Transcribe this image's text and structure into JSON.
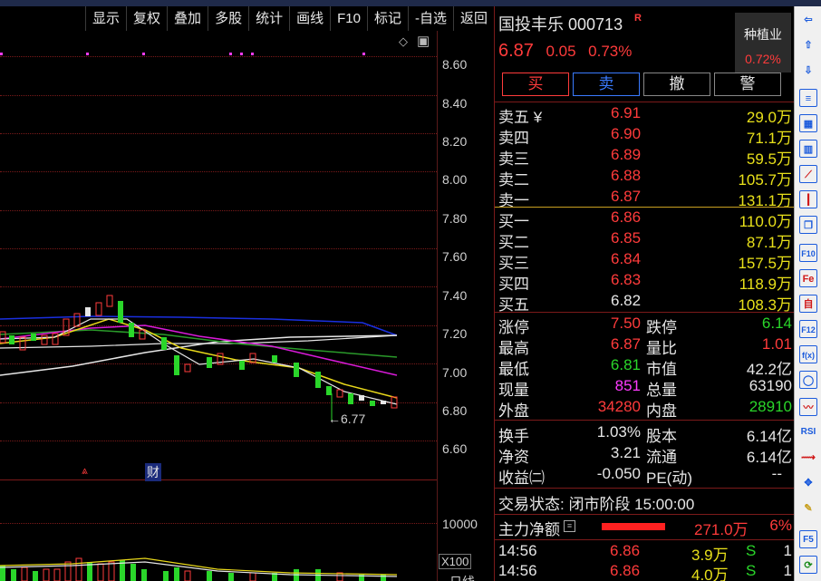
{
  "toolbar": [
    "显示",
    "复权",
    "叠加",
    "多股",
    "统计",
    "画线",
    "F10",
    "标记",
    "-自选",
    "返回"
  ],
  "price_axis": [
    "8.60",
    "8.40",
    "8.20",
    "8.00",
    "7.80",
    "7.60",
    "7.40",
    "7.20",
    "7.00",
    "6.80",
    "6.60"
  ],
  "chart_markers": {
    "low_label": "←6.77",
    "fin_label": "财",
    "vol_axis": "10000",
    "vol_unit": "X100",
    "bottom_tab": "日线"
  },
  "stock": {
    "name": "国投丰乐",
    "code": "000713",
    "r_mark": "R",
    "price": "6.87",
    "change": "0.05",
    "pct": "0.73%"
  },
  "sector": {
    "name": "种植业",
    "pct": "0.72%"
  },
  "buttons": {
    "buy": "买",
    "sell": "卖",
    "cancel": "撤",
    "alert": "警"
  },
  "asks": [
    {
      "label": "卖五 ¥",
      "price": "6.91",
      "vol": "29.0万"
    },
    {
      "label": "卖四",
      "price": "6.90",
      "vol": "71.1万"
    },
    {
      "label": "卖三",
      "price": "6.89",
      "vol": "59.5万"
    },
    {
      "label": "卖二",
      "price": "6.88",
      "vol": "105.7万"
    },
    {
      "label": "卖一",
      "price": "6.87",
      "vol": "131.1万"
    }
  ],
  "bids": [
    {
      "label": "买一",
      "price": "6.86",
      "vol": "110.0万"
    },
    {
      "label": "买二",
      "price": "6.85",
      "vol": "87.1万"
    },
    {
      "label": "买三",
      "price": "6.84",
      "vol": "157.5万"
    },
    {
      "label": "买四",
      "price": "6.83",
      "vol": "118.9万"
    },
    {
      "label": "买五",
      "price": "6.82",
      "vol": "108.3万"
    }
  ],
  "stats": {
    "zt_l": "涨停",
    "zt_v": "7.50",
    "dt_l": "跌停",
    "dt_v": "6.14",
    "hi_l": "最高",
    "hi_v": "6.87",
    "lb_l": "量比",
    "lb_v": "1.01",
    "lo_l": "最低",
    "lo_v": "6.81",
    "mv_l": "市值",
    "mv_v": "42.2亿",
    "xl_l": "现量",
    "xl_v": "851",
    "zl_l": "总量",
    "zl_v": "63190",
    "wp_l": "外盘",
    "wp_v": "34280",
    "np_l": "内盘",
    "np_v": "28910"
  },
  "stats2": {
    "hs_l": "换手",
    "hs_v": "1.03%",
    "gb_l": "股本",
    "gb_v": "6.14亿",
    "jz_l": "净资",
    "jz_v": "3.21",
    "lt_l": "流通",
    "lt_v": "6.14亿",
    "sy_l": "收益㈡",
    "sy_v": "-0.050",
    "pe_l": "PE(动)",
    "pe_v": "--"
  },
  "status": {
    "text": "交易状态: 闭市阶段 15:00:00"
  },
  "flow": {
    "label": "主力净额",
    "value": "271.0万",
    "pct": "6%"
  },
  "ticks": [
    {
      "time": "14:56",
      "price": "6.86",
      "vol": "3.9万",
      "side": "S",
      "n": "1"
    },
    {
      "time": "14:56",
      "price": "6.86",
      "vol": "4.0万",
      "side": "S",
      "n": "1"
    }
  ],
  "sidebar_icons": [
    "left-arrow-icon",
    "up-arrow-icon",
    "down-arrow-icon",
    "list-icon",
    "grid-icon",
    "bars-icon",
    "line-chart-icon",
    "candles-icon",
    "windows-icon",
    "f10-icon",
    "fe-icon",
    "self-icon",
    "f12-icon",
    "fx-icon",
    "circle-icon",
    "wave-icon",
    "rsi-icon",
    "zigzag-icon",
    "move-icon",
    "pencil-icon",
    "f5-icon",
    "refresh-icon"
  ],
  "colors": {
    "up": "#ff3b3b",
    "down": "#2ad62a",
    "grid": "#7b1a1a"
  }
}
